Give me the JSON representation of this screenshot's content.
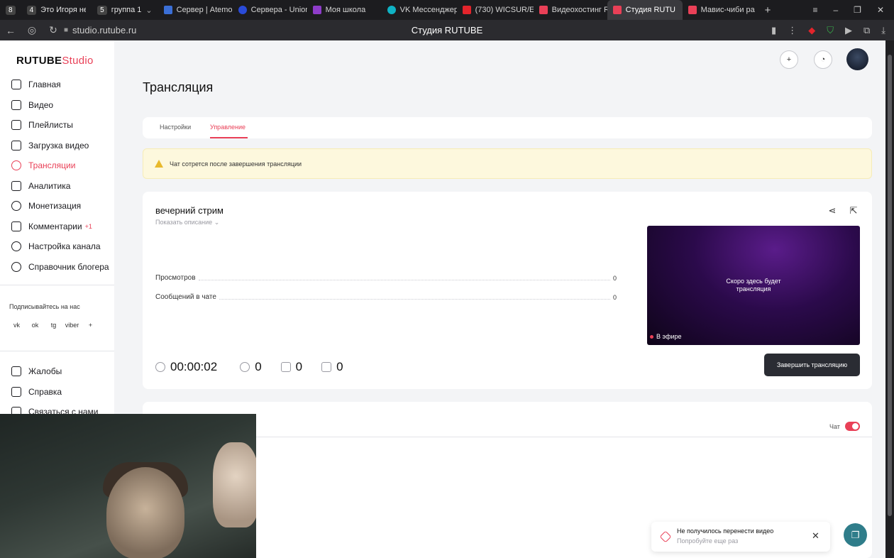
{
  "browser": {
    "tab_groups": [
      {
        "count": "8",
        "label": ""
      },
      {
        "count": "4",
        "label": "Это Игоря не тр"
      },
      {
        "count": "5",
        "label": "группа 1"
      }
    ],
    "tabs": [
      {
        "label": "Сервер | Atemo",
        "color": "#3b6fd6"
      },
      {
        "label": "Сервера - Union",
        "color": "#2a4bd9"
      },
      {
        "label": "Моя школа",
        "color": "#8e3cc9"
      },
      {
        "label": "VK Мессенджер",
        "color": "#0fb2c4"
      },
      {
        "label": "(730) WICSUR/E",
        "color": "#e3242b"
      },
      {
        "label": "Видеохостинг R",
        "color": "#e94057"
      },
      {
        "label": "Студия RUTU",
        "color": "#e94057",
        "active": true
      },
      {
        "label": "Мавис-чиби ра",
        "color": "#e94057"
      }
    ],
    "url": "studio.rutube.ru",
    "page_title": "Студия RUTUBE"
  },
  "logo": {
    "brand": "RUTUBE",
    "suffix": "Studio"
  },
  "nav": [
    {
      "label": "Главная",
      "icon": "home-icon"
    },
    {
      "label": "Видео",
      "icon": "video-icon"
    },
    {
      "label": "Плейлисты",
      "icon": "playlist-icon"
    },
    {
      "label": "Загрузка видео",
      "icon": "upload-icon"
    },
    {
      "label": "Трансляции",
      "icon": "broadcast-icon",
      "active": true
    },
    {
      "label": "Аналитика",
      "icon": "analytics-icon"
    },
    {
      "label": "Монетизация",
      "icon": "monetization-icon"
    },
    {
      "label": "Комментарии",
      "icon": "comments-icon",
      "badge": "+1"
    },
    {
      "label": "Настройка канала",
      "icon": "settings-icon"
    },
    {
      "label": "Справочник блогера",
      "icon": "guide-icon"
    }
  ],
  "follow_label": "Подписывайтесь на нас",
  "socials": [
    "vk",
    "ok",
    "tg",
    "viber",
    "+"
  ],
  "nav_bottom": [
    {
      "label": "Жалобы",
      "icon": "flag-icon"
    },
    {
      "label": "Справка",
      "icon": "help-icon"
    },
    {
      "label": "Связаться с нами",
      "icon": "mail-icon"
    }
  ],
  "page_title": "Трансляция",
  "page_tabs": [
    "Настройки",
    "Управление"
  ],
  "warning": "Чат сотрется после завершения трансляции",
  "stream": {
    "title": "вечерний стрим",
    "show_description": "Показать описание",
    "stats": [
      {
        "label": "Просмотров",
        "value": "0"
      },
      {
        "label": "Сообщений в чате",
        "value": "0"
      }
    ],
    "player_message_line1": "Скоро здесь будет",
    "player_message_line2": "трансляция",
    "live_label": "В эфире",
    "timer": "00:00:02",
    "viewers": "0",
    "likes": "0",
    "dislikes": "0",
    "end_button": "Завершить трансляцию"
  },
  "chat": {
    "label": "Чат",
    "enabled": true
  },
  "toast": {
    "title": "Не получилось перенести видео",
    "subtitle": "Попробуйте еще раз"
  }
}
